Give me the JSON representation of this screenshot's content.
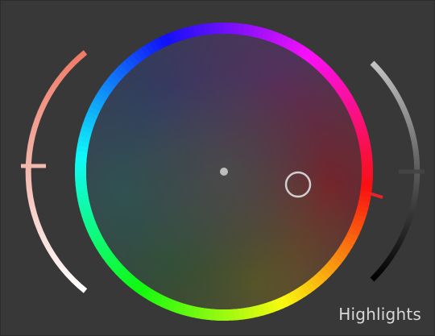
{
  "wheel": {
    "label": "Highlights",
    "selected_color": "#8a2b2b",
    "icons": {
      "center": "center-dot-icon",
      "picker": "color-picker-handle-icon"
    }
  },
  "hue_sat_slider": {
    "semantic": "hue-saturation-slider",
    "gradient_top": "#f07a66",
    "gradient_bottom": "#ffffff"
  },
  "luminance_slider": {
    "semantic": "luminance-slider",
    "gradient_top": "#bfbfbf",
    "gradient_bottom": "#000000",
    "marker_color": "#e8232b"
  }
}
